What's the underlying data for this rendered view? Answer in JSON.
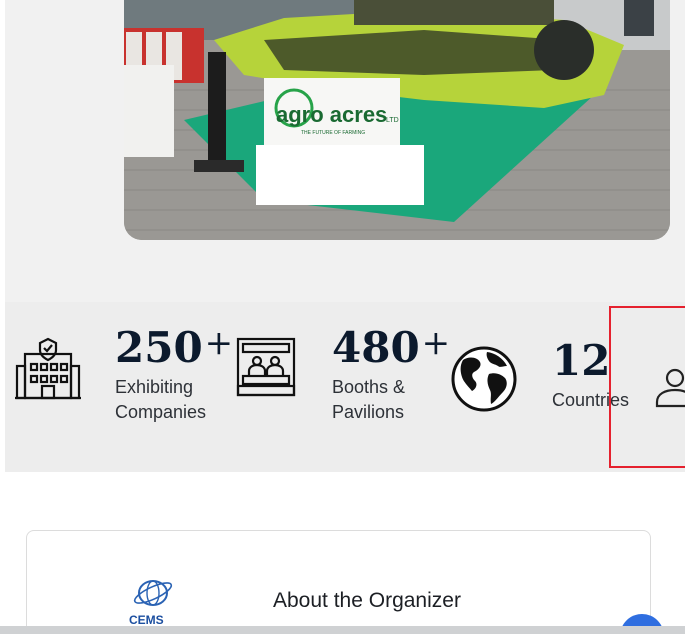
{
  "hero": {
    "sign_brand": "agro acres",
    "sign_tagline": "THE FUTURE OF FARMING",
    "sign_suffix": "LTD"
  },
  "stats": [
    {
      "number": "250",
      "suffix": "+",
      "label_line1": "Exhibiting",
      "label_line2": "Companies",
      "icon": "building-icon"
    },
    {
      "number": "480",
      "suffix": "+",
      "label_line1": "Booths &",
      "label_line2": "Pavilions",
      "icon": "booth-icon"
    },
    {
      "number": "12",
      "suffix": "",
      "label_line1": "Countries",
      "label_line2": "",
      "icon": "globe-icon"
    },
    {
      "icon": "user-icon"
    }
  ],
  "about": {
    "title": "About the Organizer",
    "logo_text": "CEMS"
  },
  "colors": {
    "number_color": "#0c1a2d",
    "highlight": "#e5212e",
    "fab": "#2f6ee0",
    "carpet": "#1aa77b",
    "machine": "#b6d33a"
  }
}
